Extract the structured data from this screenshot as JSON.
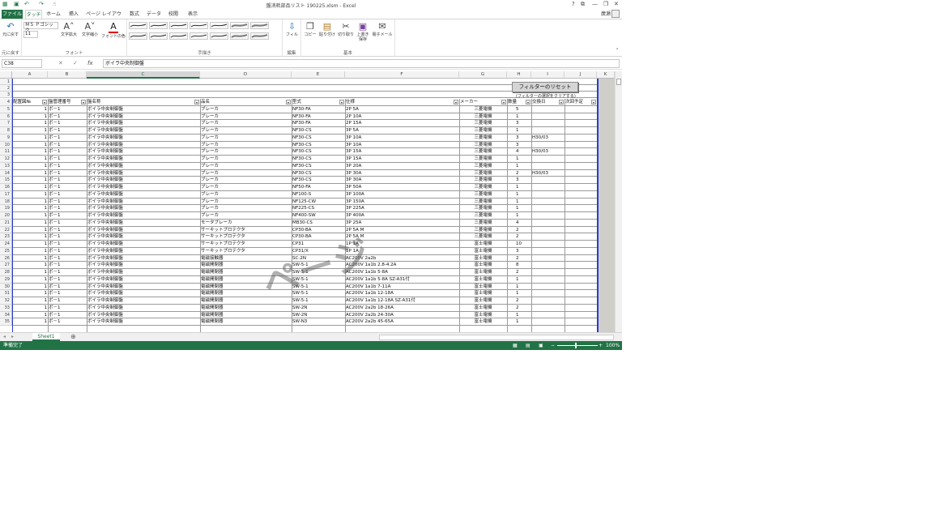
{
  "window": {
    "title": "盤消耗部品リスト 190225.xlsm - Excel",
    "help": "?",
    "restore": "⧉",
    "min": "—",
    "max": "❐",
    "close": "✕"
  },
  "tabs": [
    "ファイル",
    "タッチ",
    "ホーム",
    "挿入",
    "ページ レイアウト",
    "数式",
    "データ",
    "校閲",
    "表示"
  ],
  "user": "廣瀬",
  "ribbon": {
    "undo": "元に戻す",
    "undo_group": "元に戻す",
    "font_name": "ＭＳ Ｐゴシック",
    "font_size": "11",
    "grow": "文字拡大",
    "shrink": "文字縮小",
    "font_color": "フォントの色",
    "font_group": "フォント",
    "ink_group": "手描き",
    "fill": "フィル",
    "edit_group": "編集",
    "copy": "コピー",
    "paste": "貼り付け",
    "cut": "切り取り",
    "save": "上書き保存",
    "email": "電子メール",
    "basic_group": "基本"
  },
  "formula_bar": {
    "name_box": "C38",
    "value": "ボイラ中央制御盤"
  },
  "columns": [
    "A",
    "B",
    "C",
    "D",
    "E",
    "F",
    "G",
    "H",
    "I",
    "J",
    "K"
  ],
  "headers": [
    "配置図№",
    "盤管理番号",
    "盤名称",
    "品名",
    "型式",
    "仕様",
    "メーカー",
    "数量",
    "交換日",
    "次回予定"
  ],
  "reset_button": "フィルターのリセット",
  "reset_note": "(フィルターの選択をクリアする)",
  "rows": [
    {
      "a": "1",
      "b": "ボ－1",
      "c": "ボイラ中央制御盤",
      "d": "ブレーカ",
      "e": "NF30-FA",
      "f": "2P 5A",
      "g": "三菱電機",
      "h": "5",
      "i": ""
    },
    {
      "a": "1",
      "b": "ボ－1",
      "c": "ボイラ中央制御盤",
      "d": "ブレーカ",
      "e": "NF30-FA",
      "f": "2P 10A",
      "g": "三菱電機",
      "h": "1",
      "i": ""
    },
    {
      "a": "1",
      "b": "ボ－1",
      "c": "ボイラ中央制御盤",
      "d": "ブレーカ",
      "e": "NF30-FA",
      "f": "2P 15A",
      "g": "三菱電機",
      "h": "3",
      "i": ""
    },
    {
      "a": "1",
      "b": "ボ－1",
      "c": "ボイラ中央制御盤",
      "d": "ブレーカ",
      "e": "NF30-CS",
      "f": "3P 5A",
      "g": "三菱電機",
      "h": "1",
      "i": ""
    },
    {
      "a": "1",
      "b": "ボ－1",
      "c": "ボイラ中央制御盤",
      "d": "ブレーカ",
      "e": "NF30-CS",
      "f": "3P 10A",
      "g": "三菱電機",
      "h": "3",
      "i": "H30/03"
    },
    {
      "a": "1",
      "b": "ボ－1",
      "c": "ボイラ中央制御盤",
      "d": "ブレーカ",
      "e": "NF30-CS",
      "f": "3P 10A",
      "g": "三菱電機",
      "h": "3",
      "i": ""
    },
    {
      "a": "1",
      "b": "ボ－1",
      "c": "ボイラ中央制御盤",
      "d": "ブレーカ",
      "e": "NF30-CS",
      "f": "3P 15A",
      "g": "三菱電機",
      "h": "4",
      "i": "H30/03"
    },
    {
      "a": "1",
      "b": "ボ－1",
      "c": "ボイラ中央制御盤",
      "d": "ブレーカ",
      "e": "NF30-CS",
      "f": "3P 15A",
      "g": "三菱電機",
      "h": "1",
      "i": ""
    },
    {
      "a": "1",
      "b": "ボ－1",
      "c": "ボイラ中央制御盤",
      "d": "ブレーカ",
      "e": "NF30-CS",
      "f": "3P 20A",
      "g": "三菱電機",
      "h": "1",
      "i": ""
    },
    {
      "a": "1",
      "b": "ボ－1",
      "c": "ボイラ中央制御盤",
      "d": "ブレーカ",
      "e": "NF30-CS",
      "f": "3P 30A",
      "g": "三菱電機",
      "h": "2",
      "i": "H30/03"
    },
    {
      "a": "1",
      "b": "ボ－1",
      "c": "ボイラ中央制御盤",
      "d": "ブレーカ",
      "e": "NF30-CS",
      "f": "3P 30A",
      "g": "三菱電機",
      "h": "3",
      "i": ""
    },
    {
      "a": "1",
      "b": "ボ－1",
      "c": "ボイラ中央制御盤",
      "d": "ブレーカ",
      "e": "NF50-FA",
      "f": "3P 50A",
      "g": "三菱電機",
      "h": "1",
      "i": ""
    },
    {
      "a": "1",
      "b": "ボ－1",
      "c": "ボイラ中央制御盤",
      "d": "ブレーカ",
      "e": "NF100-S",
      "f": "3P 100A",
      "g": "三菱電機",
      "h": "1",
      "i": ""
    },
    {
      "a": "1",
      "b": "ボ－1",
      "c": "ボイラ中央制御盤",
      "d": "ブレーカ",
      "e": "NF125-CW",
      "f": "3P 150A",
      "g": "三菱電機",
      "h": "1",
      "i": ""
    },
    {
      "a": "1",
      "b": "ボ－1",
      "c": "ボイラ中央制御盤",
      "d": "ブレーカ",
      "e": "NF225-CS",
      "f": "3P 225A",
      "g": "三菱電機",
      "h": "1",
      "i": ""
    },
    {
      "a": "1",
      "b": "ボ－1",
      "c": "ボイラ中央制御盤",
      "d": "ブレーカ",
      "e": "NF400-SW",
      "f": "3P 400A",
      "g": "三菱電機",
      "h": "1",
      "i": ""
    },
    {
      "a": "1",
      "b": "ボ－1",
      "c": "ボイラ中央制御盤",
      "d": "モータブレーカ",
      "e": "MB30-CS",
      "f": "3P 25A",
      "g": "三菱電機",
      "h": "4",
      "i": ""
    },
    {
      "a": "1",
      "b": "ボ－1",
      "c": "ボイラ中央制御盤",
      "d": "サーキットプロテクタ",
      "e": "CP30-BA",
      "f": "2P 5A M",
      "g": "三菱電機",
      "h": "2",
      "i": ""
    },
    {
      "a": "1",
      "b": "ボ－1",
      "c": "ボイラ中央制御盤",
      "d": "サーキットプロテクタ",
      "e": "CP30-BA",
      "f": "2P 5A M",
      "g": "三菱電機",
      "h": "2",
      "i": ""
    },
    {
      "a": "1",
      "b": "ボ－1",
      "c": "ボイラ中央制御盤",
      "d": "サーキットプロテクタ",
      "e": "CP31",
      "f": "1P 1A",
      "g": "富士電機",
      "h": "10",
      "i": ""
    },
    {
      "a": "1",
      "b": "ボ－1",
      "c": "ボイラ中央制御盤",
      "d": "サーキットプロテクタ",
      "e": "CP31/X",
      "f": "1P 1A",
      "g": "富士電機",
      "h": "3",
      "i": ""
    },
    {
      "a": "1",
      "b": "ボ－1",
      "c": "ボイラ中央制御盤",
      "d": "電磁接触器",
      "e": "SC-2N",
      "f": "AC200V 2a2b",
      "g": "富士電機",
      "h": "2",
      "i": ""
    },
    {
      "a": "1",
      "b": "ボ－1",
      "c": "ボイラ中央制御盤",
      "d": "電磁開閉器",
      "e": "SW-5-1",
      "f": "AC200V 1a1b 2.8-4.2A",
      "g": "富士電機",
      "h": "8",
      "i": ""
    },
    {
      "a": "1",
      "b": "ボ－1",
      "c": "ボイラ中央制御盤",
      "d": "電磁開閉器",
      "e": "SW-5-1",
      "f": "AC200V 1a1b 5-8A",
      "g": "富士電機",
      "h": "2",
      "i": ""
    },
    {
      "a": "1",
      "b": "ボ－1",
      "c": "ボイラ中央制御盤",
      "d": "電磁開閉器",
      "e": "SW-5-1",
      "f": "AC200V 1a1b 5-8A SZ-A31付",
      "g": "富士電機",
      "h": "1",
      "i": ""
    },
    {
      "a": "1",
      "b": "ボ－1",
      "c": "ボイラ中央制御盤",
      "d": "電磁開閉器",
      "e": "SW-5-1",
      "f": "AC200V 1a1b 7-11A",
      "g": "富士電機",
      "h": "1",
      "i": ""
    },
    {
      "a": "1",
      "b": "ボ－1",
      "c": "ボイラ中央制御盤",
      "d": "電磁開閉器",
      "e": "SW-5-1",
      "f": "AC200V 1a1b 12-18A",
      "g": "富士電機",
      "h": "1",
      "i": ""
    },
    {
      "a": "1",
      "b": "ボ－1",
      "c": "ボイラ中央制御盤",
      "d": "電磁開閉器",
      "e": "SW-5-1",
      "f": "AC200V 1a1b 12-18A SZ-A31付",
      "g": "富士電機",
      "h": "2",
      "i": ""
    },
    {
      "a": "1",
      "b": "ボ－1",
      "c": "ボイラ中央制御盤",
      "d": "電磁開閉器",
      "e": "SW-2N",
      "f": "AC200V 2a2b 18-26A",
      "g": "富士電機",
      "h": "2",
      "i": ""
    },
    {
      "a": "1",
      "b": "ボ－1",
      "c": "ボイラ中央制御盤",
      "d": "電磁開閉器",
      "e": "SW-2N",
      "f": "AC200V 2a2b 24-30A",
      "g": "富士電機",
      "h": "1",
      "i": ""
    },
    {
      "a": "1",
      "b": "ボ－1",
      "c": "ボイラ中央制御盤",
      "d": "電磁開閉器",
      "e": "SW-N3",
      "f": "AC200V 2a2b 45-65A",
      "g": "富士電機",
      "h": "1",
      "i": ""
    }
  ],
  "row_numbers": [
    "1",
    "2",
    "3",
    "4",
    "5",
    "6",
    "7",
    "8",
    "9",
    "10",
    "11",
    "12",
    "13",
    "14",
    "15",
    "16",
    "17",
    "18",
    "19",
    "20",
    "21",
    "22",
    "23",
    "24",
    "25",
    "26",
    "27",
    "28",
    "29",
    "30",
    "31",
    "32",
    "33",
    "34",
    "35"
  ],
  "watermark": "ページ",
  "sheet_tab": "Sheet1",
  "add_sheet": "⊕",
  "status": {
    "ready": "準備完了",
    "zoom": "100%"
  },
  "colors": {
    "excel_green": "#217346",
    "watermark": "#505050"
  }
}
